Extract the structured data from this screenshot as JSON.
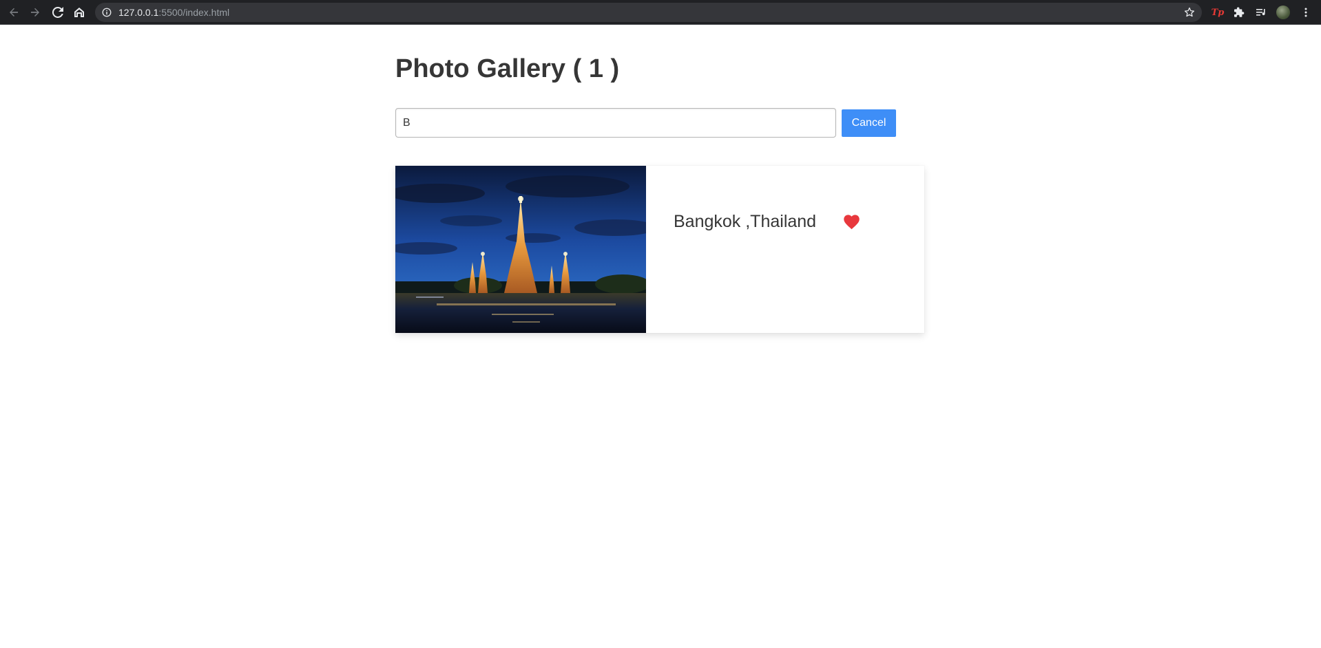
{
  "browser": {
    "url_host": "127.0.0.1",
    "url_rest": ":5500/index.html",
    "extension_tp_label": "Tp",
    "icons": [
      "back-icon",
      "forward-icon",
      "reload-icon",
      "home-icon",
      "info-icon",
      "star-icon",
      "extensions-icon",
      "reading-list-icon",
      "menu-icon"
    ]
  },
  "page": {
    "title": "Photo Gallery ( 1 )",
    "search": {
      "value": "B",
      "placeholder": ""
    },
    "cancel_label": "Cancel",
    "results": [
      {
        "caption": "Bangkok ,Thailand",
        "liked": true
      }
    ]
  },
  "colors": {
    "accent": "#3e8ef7",
    "heart": "#e8383d",
    "text": "#363636"
  }
}
